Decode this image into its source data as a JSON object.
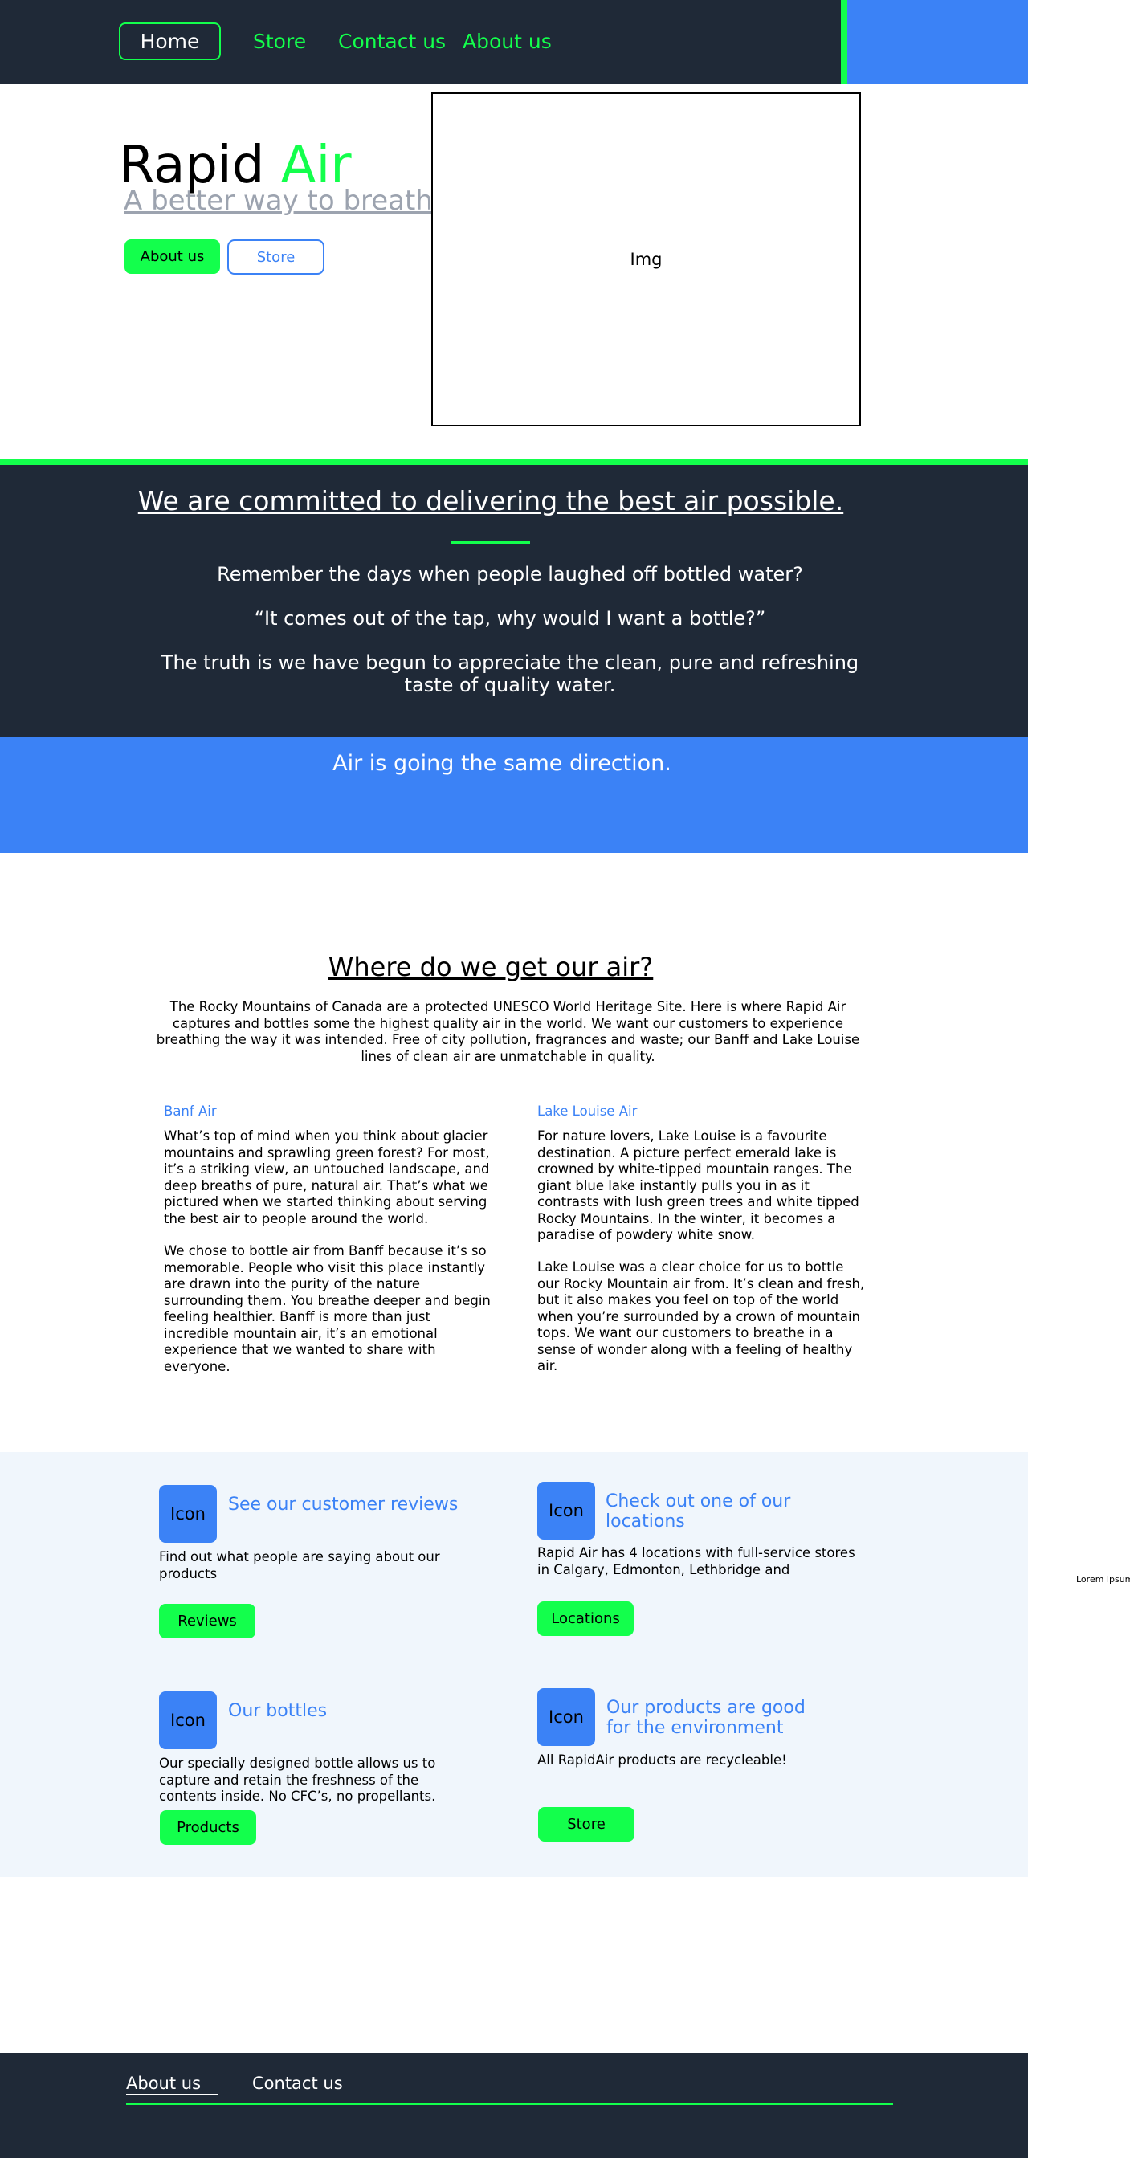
{
  "nav": {
    "home": "Home",
    "store": "Store",
    "contact": "Contact us",
    "about": "About us"
  },
  "hero": {
    "brand_word1": "Rapid",
    "brand_word2": "Air",
    "tagline": "A better way to breath",
    "btn_about": "About us",
    "btn_store": "Store",
    "image_placeholder": "Img"
  },
  "commitment": {
    "title": "We are committed to delivering the best air possible.",
    "p1": "Remember the days when people laughed off bottled water?",
    "p2": "“It comes out of the tap, why would I want a bottle?”",
    "p3": "The truth is we have begun to appreciate the clean, pure and refreshing taste of quality water.",
    "banner": "Air is going the same direction."
  },
  "where": {
    "title": "Where do we get our air?",
    "intro": "The Rocky Mountains of Canada are a protected UNESCO World Heritage Site. Here is where Rapid Air captures and bottles some the highest quality air in the world. We want our customers to experience breathing the way it was intended. Free of city pollution, fragrances and waste; our Banff and Lake Louise lines of clean air are unmatchable in quality.",
    "banff": {
      "heading": "Banf Air",
      "p1": "What’s top of mind when you think about glacier mountains and sprawling green forest? For most, it’s a striking view, an untouched landscape, and deep breaths of pure, natural air. That’s what we pictured when we started thinking about serving the best air to people around the world.",
      "p2": "We chose to bottle air from Banff because it’s so memorable. People who visit this place instantly are drawn into the purity of the nature surrounding them. You breathe deeper and begin feeling healthier. Banff is more than just incredible mountain air, it’s an emotional experience that we wanted to share with everyone."
    },
    "lake_louise": {
      "heading": "Lake Louise Air",
      "p1": "For nature lovers, Lake Louise is a favourite destination. A picture perfect emerald lake is crowned by white-tipped mountain ranges. The giant blue lake instantly pulls you in as it contrasts with lush green trees and white tipped Rocky Mountains. In the winter, it becomes a paradise of powdery white snow.",
      "p2": "Lake Louise was a clear choice for us to bottle our Rocky Mountain air from. It’s clean and fresh, but it also makes you feel on top of the world when you’re surrounded by a crown of mountain tops. We want our customers to breathe in a sense of wonder along with a feeling of healthy air."
    }
  },
  "features": {
    "icon_label": "Icon",
    "reviews": {
      "title": "See our customer reviews",
      "text": "Find out what people are saying about our products",
      "button": "Reviews"
    },
    "locations": {
      "title": "Check out one of our locations",
      "text": "Rapid Air has 4 locations with full-service stores in Calgary, Edmonton, Lethbridge and",
      "button": "Locations"
    },
    "bottles": {
      "title": "Our bottles",
      "text": "Our specially designed bottle allows us to capture and retain the freshness of the contents inside. No CFC’s, no propellants.",
      "button": "Products"
    },
    "environment": {
      "title": "Our products are good for the environment",
      "text": "All RapidAir products are recycleable!",
      "button": "Store"
    }
  },
  "side_note": "Lorem ipsum",
  "footer": {
    "about": "About us",
    "contact": "Contact us"
  },
  "colors": {
    "dark": "#1f2937",
    "green": "#13ff4c",
    "blue": "#3b82f6",
    "light_bg": "#f0f6fc"
  }
}
